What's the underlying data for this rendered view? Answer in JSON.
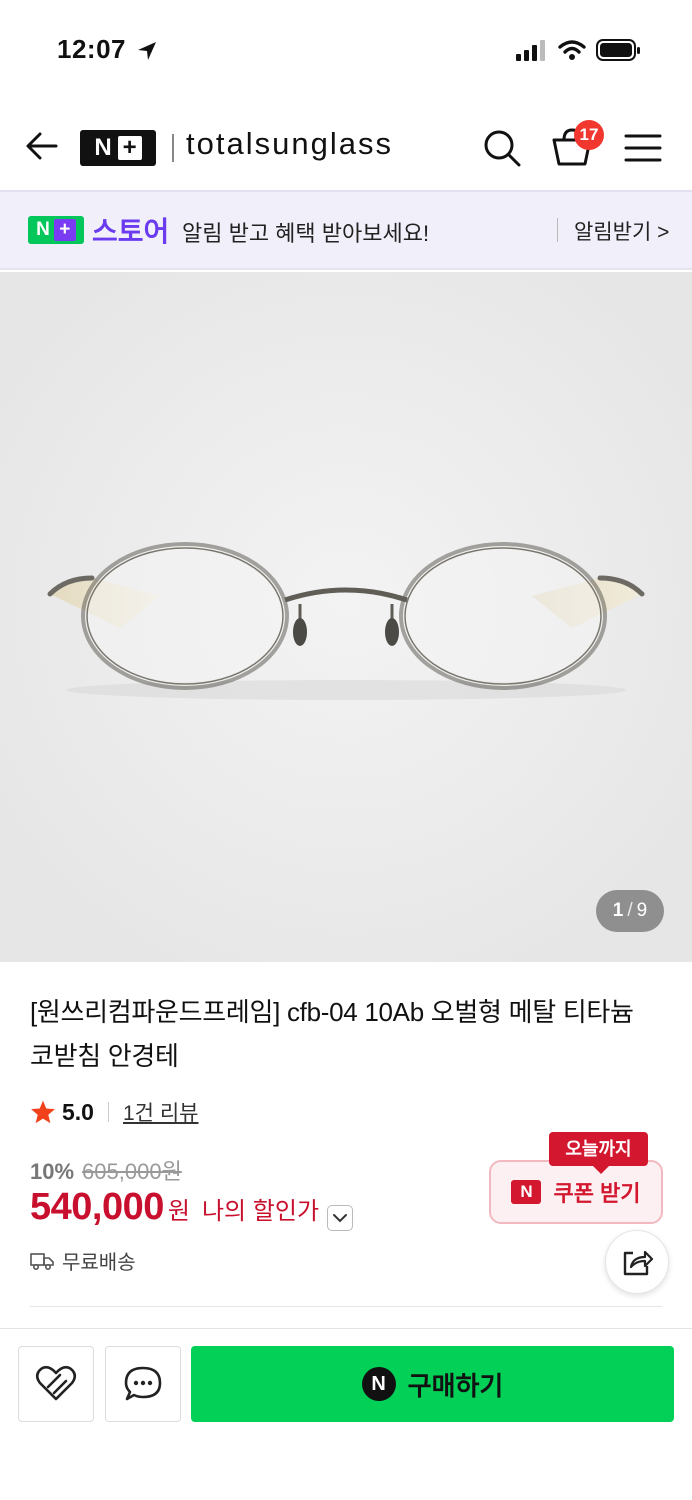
{
  "status_bar": {
    "time": "12:07"
  },
  "header": {
    "brand_logo_text": "N",
    "brand_logo_plus": "+",
    "brand_name": "totalsunglass",
    "cart_count": "17",
    "icons": [
      "back-arrow-icon",
      "search-icon",
      "cart-icon",
      "menu-icon"
    ]
  },
  "notice_bar": {
    "logo_n": "N",
    "logo_plus": "+",
    "store_label": "스토어",
    "message": "알림 받고 혜택 받아보세요!",
    "action": "알림받기 >"
  },
  "gallery": {
    "current": "1",
    "separator": "/",
    "total": "9"
  },
  "product": {
    "title": "[원쓰리컴파운드프레임] cfb-04 10Ab 오벌형 메탈 티타늄 코받침 안경테",
    "rating": "5.0",
    "review_link": "1건 리뷰",
    "discount_rate": "10%",
    "original_price": "605,000원",
    "sale_price": "540,000",
    "price_unit": "원",
    "my_price_label": "나의 할인가",
    "shipping": "무료배송"
  },
  "coupon": {
    "tag": "오늘까지",
    "logo": "N",
    "label": "쿠폰 받기"
  },
  "bottom_bar": {
    "npay_logo": "N",
    "buy_label": "구매하기"
  },
  "colors": {
    "brand_green": "#03c75a",
    "buy_green": "#03d157",
    "price_red": "#c8102e",
    "coupon_red": "#d3172f",
    "store_purple": "#6b3bf0",
    "badge_red": "#f2372f"
  }
}
